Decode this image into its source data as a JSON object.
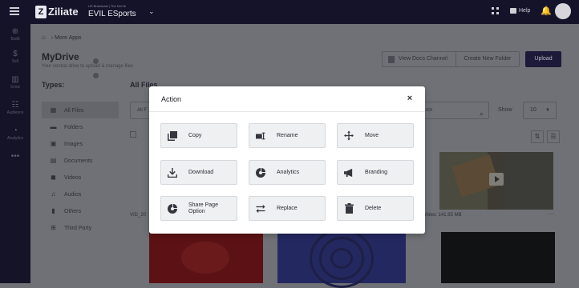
{
  "topbar": {
    "logo_letter": "Z",
    "logo_text": "Ziliate",
    "org_small": "US Brandcast | The Dev'te",
    "org_name": "EVIL ESports",
    "org_chevron": "⌄",
    "help_label": "Help"
  },
  "rail": {
    "items": [
      {
        "icon": "⊕",
        "label": "Build"
      },
      {
        "icon": "$",
        "label": "Sell"
      },
      {
        "icon": "▥",
        "label": "Grow"
      },
      {
        "icon": "☷",
        "label": "Audience"
      },
      {
        "icon": "◔",
        "label": "Analytics"
      },
      {
        "icon": "•••",
        "label": ""
      }
    ]
  },
  "breadcrumb": {
    "home_icon": "⌂",
    "separator": "›",
    "current": "More Apps"
  },
  "page": {
    "title": "MyDrive",
    "subtitle": "Your central drive to upload & manage files",
    "view_docs_label": "View Docs Channel",
    "new_folder_label": "Create New Folder",
    "upload_label": "Upload"
  },
  "types": {
    "heading": "Types:",
    "items": [
      {
        "icon": "▦",
        "label": "All Files",
        "active": true
      },
      {
        "icon": "▬",
        "label": "Folders"
      },
      {
        "icon": "▣",
        "label": "Images"
      },
      {
        "icon": "▤",
        "label": "Documents"
      },
      {
        "icon": "◼",
        "label": "Videos"
      },
      {
        "icon": "♫",
        "label": "Audios"
      },
      {
        "icon": "▮",
        "label": "Others"
      },
      {
        "icon": "⊞",
        "label": "Third Party"
      }
    ]
  },
  "files": {
    "heading": "All Files",
    "filter_value": "All F",
    "search_value": "rch",
    "show_label": "Show",
    "per_page": "10",
    "file_name_left": "VID_20",
    "file_name_right": "Video: 141.95 MB",
    "card_menu": "···"
  },
  "modal": {
    "title": "Action",
    "close": "×",
    "actions": [
      {
        "icon": "copy-icon",
        "label": "Copy"
      },
      {
        "icon": "rename-icon",
        "label": "Rename"
      },
      {
        "icon": "move-icon",
        "label": "Move"
      },
      {
        "icon": "download-icon",
        "label": "Download"
      },
      {
        "icon": "analytics-icon",
        "label": "Analytics"
      },
      {
        "icon": "branding-icon",
        "label": "Branding"
      },
      {
        "icon": "share-icon",
        "label": "Share Page Option"
      },
      {
        "icon": "replace-icon",
        "label": "Replace"
      },
      {
        "icon": "delete-icon",
        "label": "Delete"
      }
    ]
  },
  "colors": {
    "topbar": "#15132a",
    "overlay_background": "#6f7176",
    "upload_button": "#1c1a38",
    "action_button_bg": "#eef0f2",
    "icon_gray": "#35363d"
  }
}
